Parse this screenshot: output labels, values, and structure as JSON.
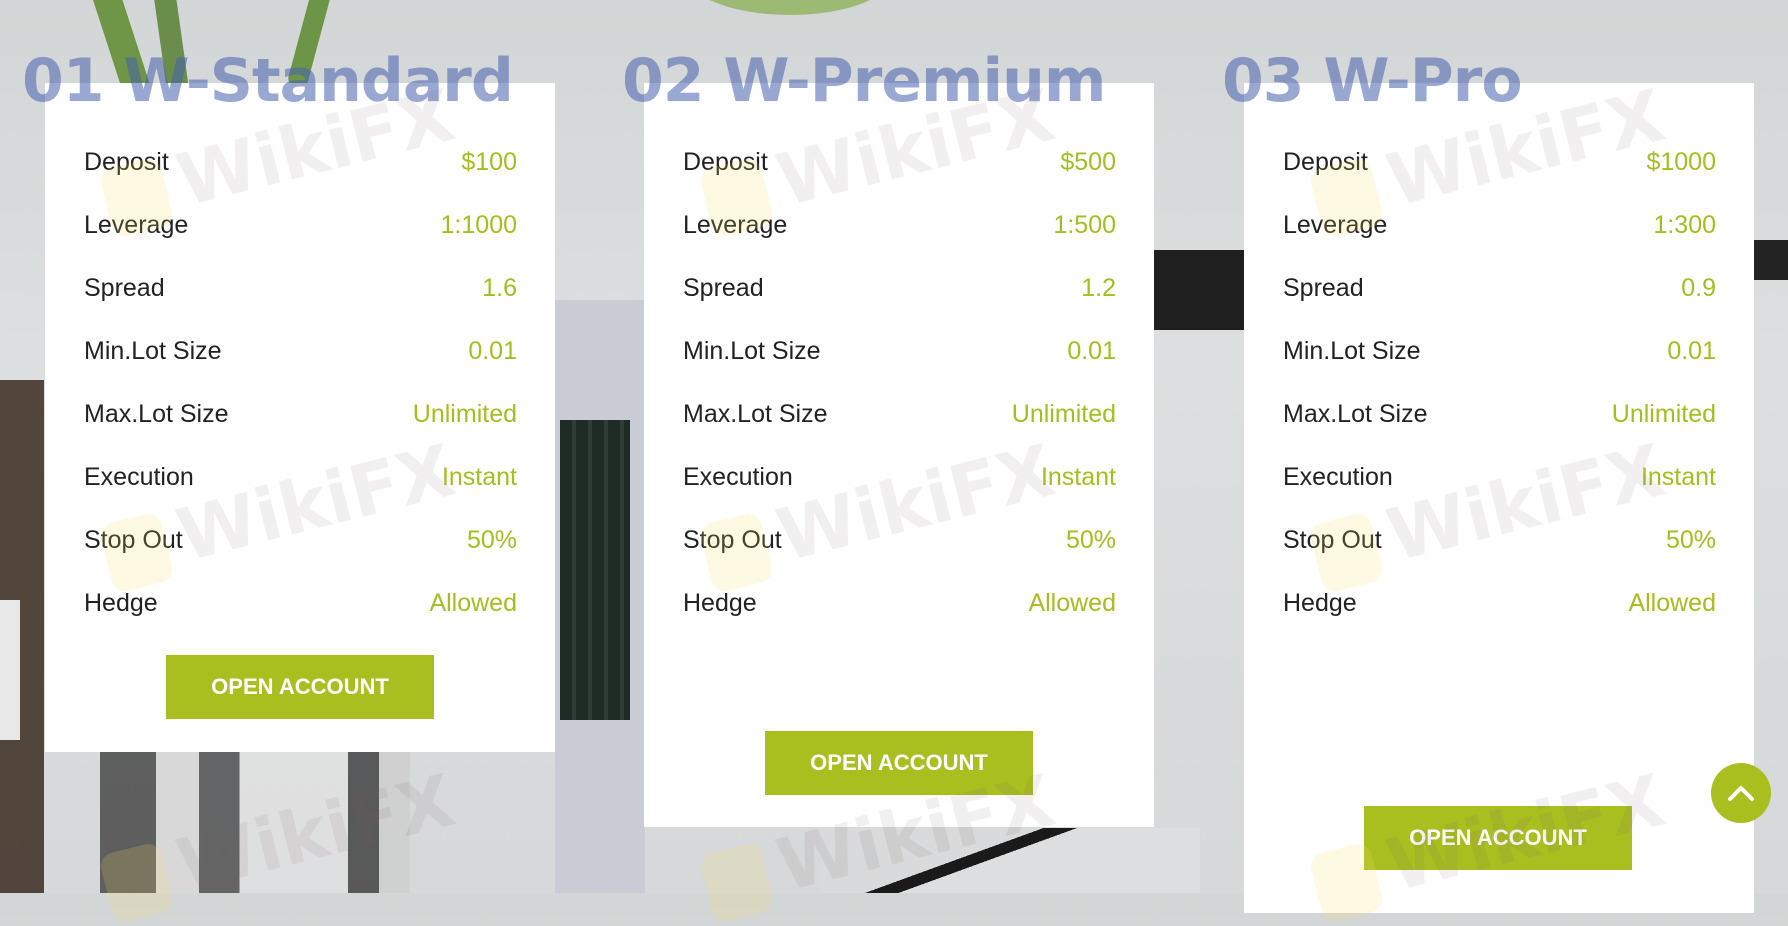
{
  "accent_color": "#a9bf20",
  "title_color": "#4660af",
  "plans": [
    {
      "title": "01 W-Standard",
      "rows": [
        {
          "label": "Deposit",
          "value": "$100"
        },
        {
          "label": "Leverage",
          "value": "1:1000"
        },
        {
          "label": "Spread",
          "value": "1.6"
        },
        {
          "label": "Min.Lot Size",
          "value": "0.01"
        },
        {
          "label": "Max.Lot Size",
          "value": "Unlimited"
        },
        {
          "label": "Execution",
          "value": "Instant"
        },
        {
          "label": "Stop Out",
          "value": "50%"
        },
        {
          "label": "Hedge",
          "value": "Allowed"
        }
      ],
      "button_label": "OPEN ACCOUNT"
    },
    {
      "title": "02 W-Premium",
      "rows": [
        {
          "label": "Deposit",
          "value": "$500"
        },
        {
          "label": "Leverage",
          "value": "1:500"
        },
        {
          "label": "Spread",
          "value": "1.2"
        },
        {
          "label": "Min.Lot Size",
          "value": "0.01"
        },
        {
          "label": "Max.Lot Size",
          "value": "Unlimited"
        },
        {
          "label": "Execution",
          "value": "Instant"
        },
        {
          "label": "Stop Out",
          "value": "50%"
        },
        {
          "label": "Hedge",
          "value": "Allowed"
        }
      ],
      "button_label": "OPEN ACCOUNT"
    },
    {
      "title": "03 W-Pro",
      "rows": [
        {
          "label": "Deposit",
          "value": "$1000"
        },
        {
          "label": "Leverage",
          "value": "1:300"
        },
        {
          "label": "Spread",
          "value": "0.9"
        },
        {
          "label": "Min.Lot Size",
          "value": "0.01"
        },
        {
          "label": "Max.Lot Size",
          "value": "Unlimited"
        },
        {
          "label": "Execution",
          "value": "Instant"
        },
        {
          "label": "Stop Out",
          "value": "50%"
        },
        {
          "label": "Hedge",
          "value": "Allowed"
        }
      ],
      "button_label": "OPEN ACCOUNT"
    }
  ],
  "scroll_top": {
    "icon": "chevron-up-icon"
  },
  "watermark": {
    "text": "WikiFX"
  }
}
